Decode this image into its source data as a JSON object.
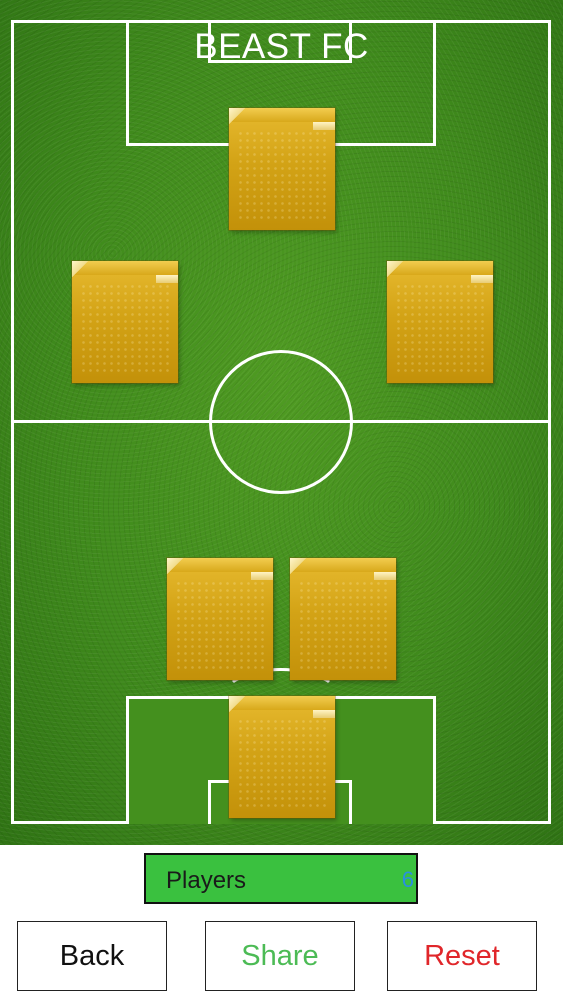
{
  "team": {
    "name": "BEAST FC"
  },
  "formation": {
    "slots": [
      {
        "role": "forward"
      },
      {
        "role": "left-wing"
      },
      {
        "role": "right-wing"
      },
      {
        "role": "left-defender"
      },
      {
        "role": "right-defender"
      },
      {
        "role": "goalkeeper"
      }
    ]
  },
  "players_bar": {
    "label": "Players",
    "count": "6"
  },
  "buttons": {
    "back": "Back",
    "share": "Share",
    "reset": "Reset"
  },
  "colors": {
    "pitch_green": "#3f8a1c",
    "card_gold": "#d3a316",
    "players_bar": "#3ac13f",
    "share_text": "#4cbb55",
    "reset_text": "#e0262a",
    "count_text": "#2a8fe0"
  }
}
